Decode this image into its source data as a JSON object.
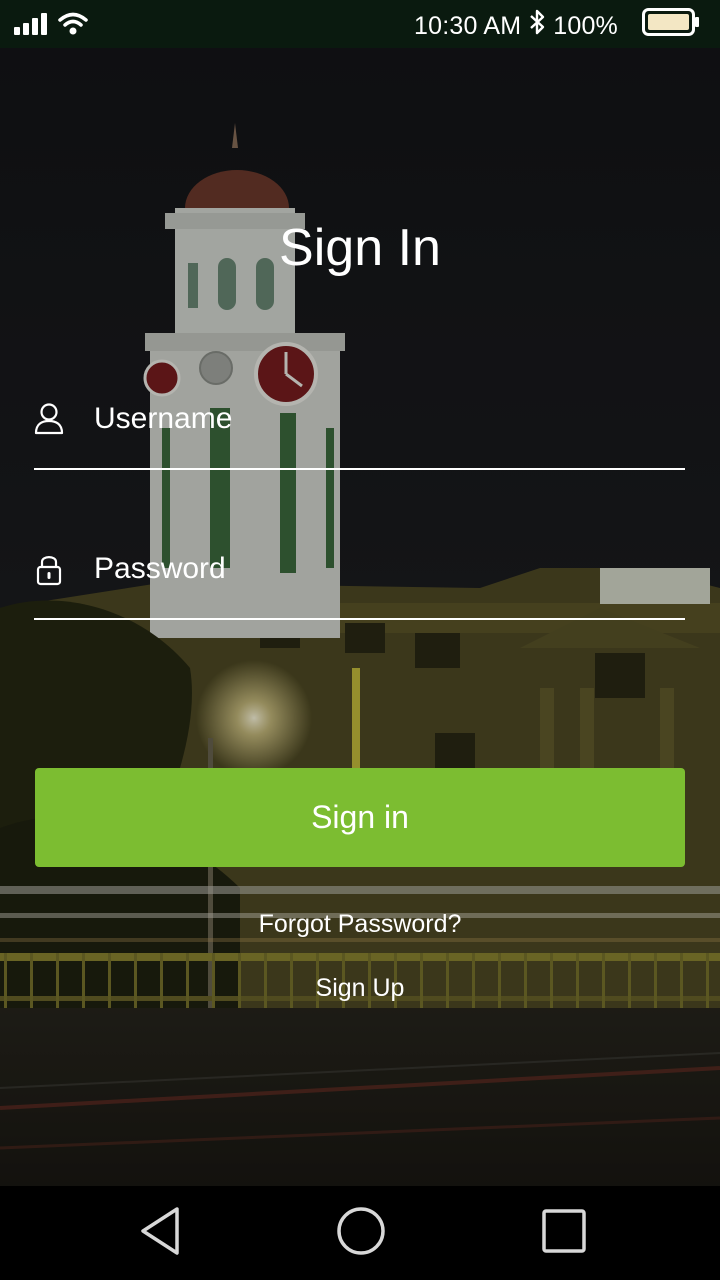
{
  "status_bar": {
    "time": "10:30 AM",
    "battery_percent": "100%",
    "icons": [
      "signal-icon",
      "wifi-icon",
      "bluetooth-icon",
      "battery-icon"
    ],
    "battery_level": 1.0
  },
  "login": {
    "title": "Sign In",
    "username_placeholder": "Username",
    "password_placeholder": "Password",
    "username_value": "",
    "password_value": "",
    "signin_label": "Sign in",
    "forgot_label": "Forgot Password?",
    "signup_label": "Sign Up"
  },
  "colors": {
    "accent": "#7cbd31",
    "status_bar_bg": "#0a1a0f",
    "text": "#ffffff"
  },
  "nav_bar": {
    "icons": [
      "back-icon",
      "home-icon",
      "recents-icon"
    ]
  }
}
